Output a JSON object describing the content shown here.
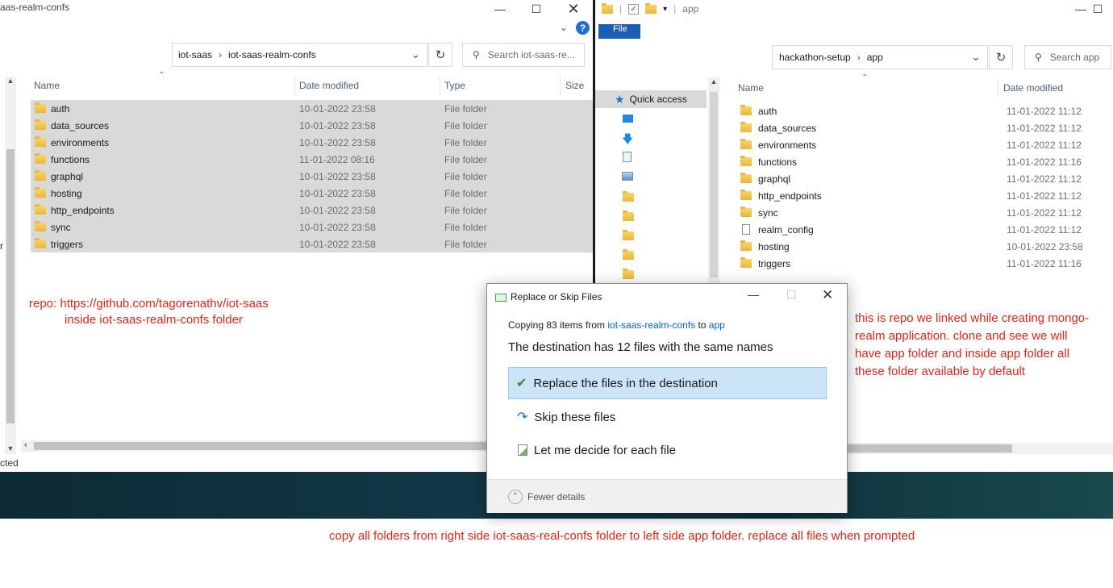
{
  "left_window": {
    "title": "aas-realm-confs",
    "breadcrumb": [
      "iot-saas",
      "iot-saas-realm-confs"
    ],
    "search_placeholder": "Search iot-saas-re...",
    "columns": [
      "Name",
      "Date modified",
      "Type",
      "Size"
    ],
    "rows": [
      {
        "name": "auth",
        "date": "10-01-2022 23:58",
        "type": "File folder"
      },
      {
        "name": "data_sources",
        "date": "10-01-2022 23:58",
        "type": "File folder"
      },
      {
        "name": "environments",
        "date": "10-01-2022 23:58",
        "type": "File folder"
      },
      {
        "name": "functions",
        "date": "11-01-2022 08:16",
        "type": "File folder"
      },
      {
        "name": "graphql",
        "date": "10-01-2022 23:58",
        "type": "File folder"
      },
      {
        "name": "hosting",
        "date": "10-01-2022 23:58",
        "type": "File folder"
      },
      {
        "name": "http_endpoints",
        "date": "10-01-2022 23:58",
        "type": "File folder"
      },
      {
        "name": "sync",
        "date": "10-01-2022 23:58",
        "type": "File folder"
      },
      {
        "name": "triggers",
        "date": "10-01-2022 23:58",
        "type": "File folder"
      }
    ],
    "status": "cted",
    "side_letter": "r"
  },
  "right_window": {
    "title": "app",
    "tabs_partial": "File",
    "breadcrumb": [
      "hackathon-setup",
      "app"
    ],
    "search_placeholder": "Search app",
    "nav_quick_access": "Quick access",
    "columns": [
      "Name",
      "Date modified"
    ],
    "rows": [
      {
        "name": "auth",
        "date": "11-01-2022 11:12",
        "icon": "folder"
      },
      {
        "name": "data_sources",
        "date": "11-01-2022 11:12",
        "icon": "folder"
      },
      {
        "name": "environments",
        "date": "11-01-2022 11:12",
        "icon": "folder"
      },
      {
        "name": "functions",
        "date": "11-01-2022 11:16",
        "icon": "folder"
      },
      {
        "name": "graphql",
        "date": "11-01-2022 11:12",
        "icon": "folder"
      },
      {
        "name": "http_endpoints",
        "date": "11-01-2022 11:12",
        "icon": "folder"
      },
      {
        "name": "sync",
        "date": "11-01-2022 11:12",
        "icon": "folder"
      },
      {
        "name": "realm_config",
        "date": "11-01-2022 11:12",
        "icon": "file"
      },
      {
        "name": "hosting",
        "date": "10-01-2022 23:58",
        "icon": "folder"
      },
      {
        "name": "triggers",
        "date": "11-01-2022 11:16",
        "icon": "folder"
      }
    ]
  },
  "dialog": {
    "title": "Replace or Skip Files",
    "copying_prefix": "Copying 83 items from",
    "source": "iot-saas-realm-confs",
    "to_word": "to",
    "dest": "app",
    "message": "The destination has 12 files with the same names",
    "options": [
      "Replace the files in the destination",
      "Skip these files",
      "Let me decide for each file"
    ],
    "fewer_details": "Fewer details"
  },
  "annotations": {
    "repo_line1": "repo:  https://github.com/tagorenathv/iot-saas",
    "repo_line2": "inside iot-saas-realm-confs folder",
    "right_note": [
      "this is repo we linked while creating mongo-",
      "realm application. clone and see we will",
      "have app folder and inside app folder all",
      "these folder available by default"
    ],
    "bottom_note": "copy all folders from right side iot-saas-real-confs folder to left side app folder. replace all files when prompted"
  },
  "colors": {
    "annotation_red": "#e1241c",
    "selection_gray": "#d9d9d9",
    "dialog_primary": "#cce4f7",
    "link_blue": "#0066cc"
  }
}
